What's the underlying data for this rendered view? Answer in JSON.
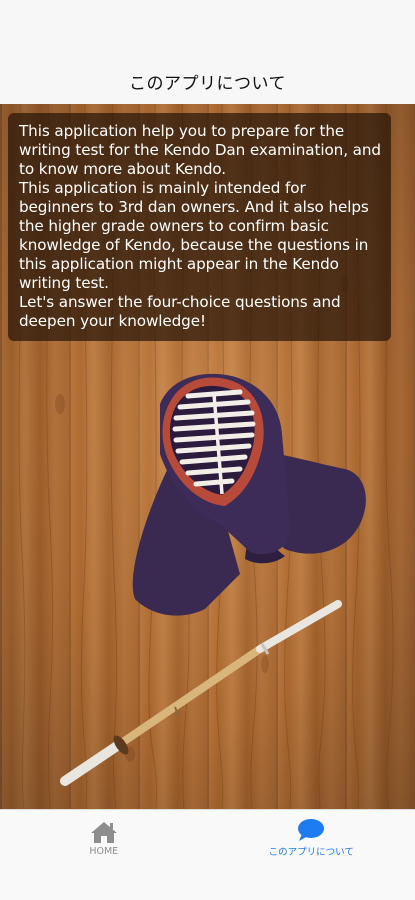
{
  "header": {
    "title": "このアプリについて"
  },
  "about": {
    "paragraphs": [
      "This application help you to prepare for the writing test for the Kendo Dan examination, and to know more about Kendo.",
      "This application is mainly intended for beginners to 3rd dan owners. And it also helps the higher grade owners to confirm basic knowledge of Kendo, because the questions in this application might appear in the Kendo writing test.",
      "Let's answer the four-choice questions and deepen your knowledge!"
    ]
  },
  "illustration": {
    "items": [
      "kendo-men-helmet",
      "shinai-bamboo-sword"
    ]
  },
  "tabbar": {
    "tabs": [
      {
        "label": "HOME",
        "icon": "home-icon",
        "active": false
      },
      {
        "label": "このアプリについて",
        "icon": "chat-bubble-icon",
        "active": true
      }
    ],
    "active_color": "#1e7cf2",
    "inactive_color": "#8e8e8e"
  }
}
